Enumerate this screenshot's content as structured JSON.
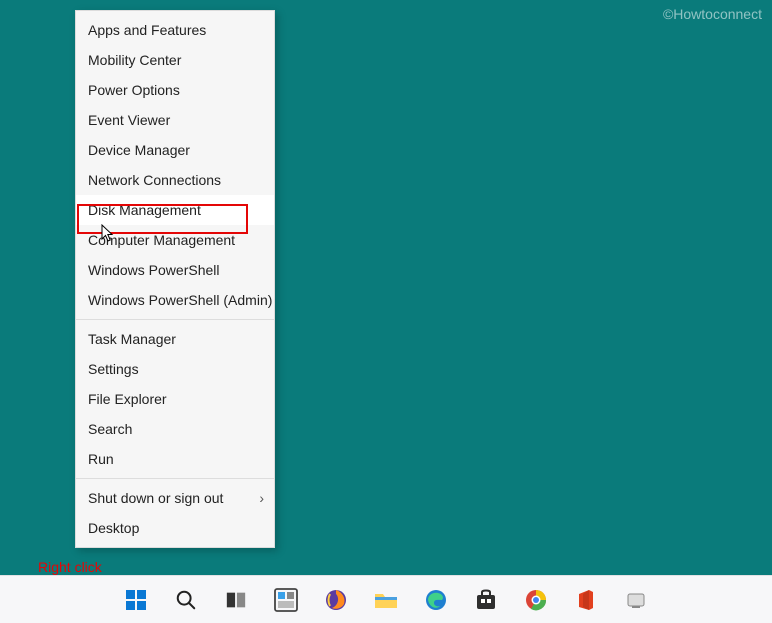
{
  "watermark": "©Howtoconnect",
  "annotation": {
    "label": "Right click"
  },
  "menu": {
    "groups": [
      [
        {
          "id": "apps-features",
          "label": "Apps and Features",
          "hover": false,
          "sub": false
        },
        {
          "id": "mobility-center",
          "label": "Mobility Center",
          "hover": false,
          "sub": false
        },
        {
          "id": "power-options",
          "label": "Power Options",
          "hover": false,
          "sub": false
        },
        {
          "id": "event-viewer",
          "label": "Event Viewer",
          "hover": false,
          "sub": false
        },
        {
          "id": "device-manager",
          "label": "Device Manager",
          "hover": false,
          "sub": false
        },
        {
          "id": "network-connections",
          "label": "Network Connections",
          "hover": false,
          "sub": false
        },
        {
          "id": "disk-management",
          "label": "Disk Management",
          "hover": true,
          "sub": false
        },
        {
          "id": "computer-management",
          "label": "Computer Management",
          "hover": false,
          "sub": false
        },
        {
          "id": "windows-powershell",
          "label": "Windows PowerShell",
          "hover": false,
          "sub": false
        },
        {
          "id": "windows-powershell-admin",
          "label": "Windows PowerShell (Admin)",
          "hover": false,
          "sub": false
        }
      ],
      [
        {
          "id": "task-manager",
          "label": "Task Manager",
          "hover": false,
          "sub": false
        },
        {
          "id": "settings",
          "label": "Settings",
          "hover": false,
          "sub": false
        },
        {
          "id": "file-explorer",
          "label": "File Explorer",
          "hover": false,
          "sub": false
        },
        {
          "id": "search",
          "label": "Search",
          "hover": false,
          "sub": false
        },
        {
          "id": "run",
          "label": "Run",
          "hover": false,
          "sub": false
        }
      ],
      [
        {
          "id": "shutdown-signout",
          "label": "Shut down or sign out",
          "hover": false,
          "sub": true
        },
        {
          "id": "desktop",
          "label": "Desktop",
          "hover": false,
          "sub": false
        }
      ]
    ]
  },
  "taskbar": {
    "icons": [
      {
        "id": "start",
        "name": "start-icon"
      },
      {
        "id": "search",
        "name": "search-icon"
      },
      {
        "id": "taskview",
        "name": "taskview-icon"
      },
      {
        "id": "widgets",
        "name": "widgets-icon"
      },
      {
        "id": "firefox",
        "name": "firefox-icon"
      },
      {
        "id": "explorer",
        "name": "file-explorer-icon"
      },
      {
        "id": "edge",
        "name": "edge-icon"
      },
      {
        "id": "store",
        "name": "store-icon"
      },
      {
        "id": "chrome",
        "name": "chrome-icon"
      },
      {
        "id": "office",
        "name": "office-icon"
      },
      {
        "id": "generic",
        "name": "app-icon"
      }
    ]
  }
}
